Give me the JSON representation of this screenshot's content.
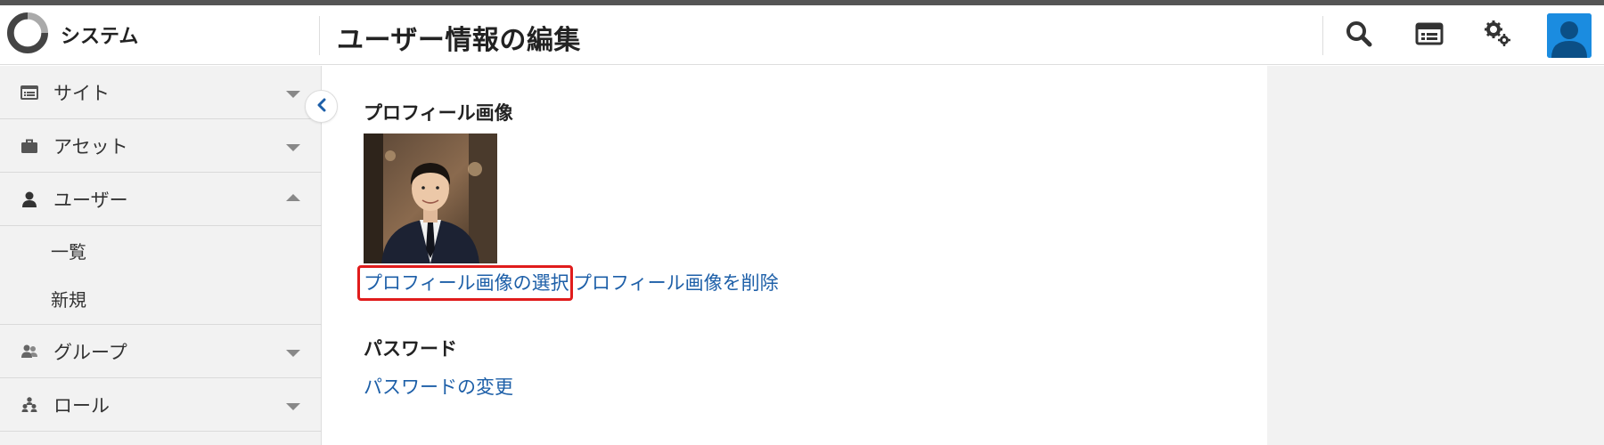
{
  "app": {
    "brand_name": "システム"
  },
  "header": {
    "page_title": "ユーザー情報の編集",
    "icons": [
      "search-icon",
      "dashboard-icon",
      "settings-icon",
      "user-avatar-icon"
    ]
  },
  "sidebar": {
    "items": [
      {
        "label": "サイト",
        "icon": "site-icon",
        "expanded": false
      },
      {
        "label": "アセット",
        "icon": "briefcase-icon",
        "expanded": false
      },
      {
        "label": "ユーザー",
        "icon": "user-icon",
        "expanded": true
      },
      {
        "label": "グループ",
        "icon": "group-icon",
        "expanded": false
      },
      {
        "label": "ロール",
        "icon": "role-icon",
        "expanded": false
      }
    ],
    "user_subitems": [
      {
        "label": "一覧"
      },
      {
        "label": "新規"
      }
    ]
  },
  "main": {
    "profile_section_label": "プロフィール画像",
    "select_image_link": "プロフィール画像の選択",
    "delete_image_link": "プロフィール画像を削除",
    "password_section_label": "パスワード",
    "change_password_link": "パスワードの変更"
  },
  "colors": {
    "link": "#1d5fa8",
    "accent_avatar": "#1b8ce0",
    "highlight": "#e01c1c",
    "sidebar_bg": "#f2f2f2"
  }
}
